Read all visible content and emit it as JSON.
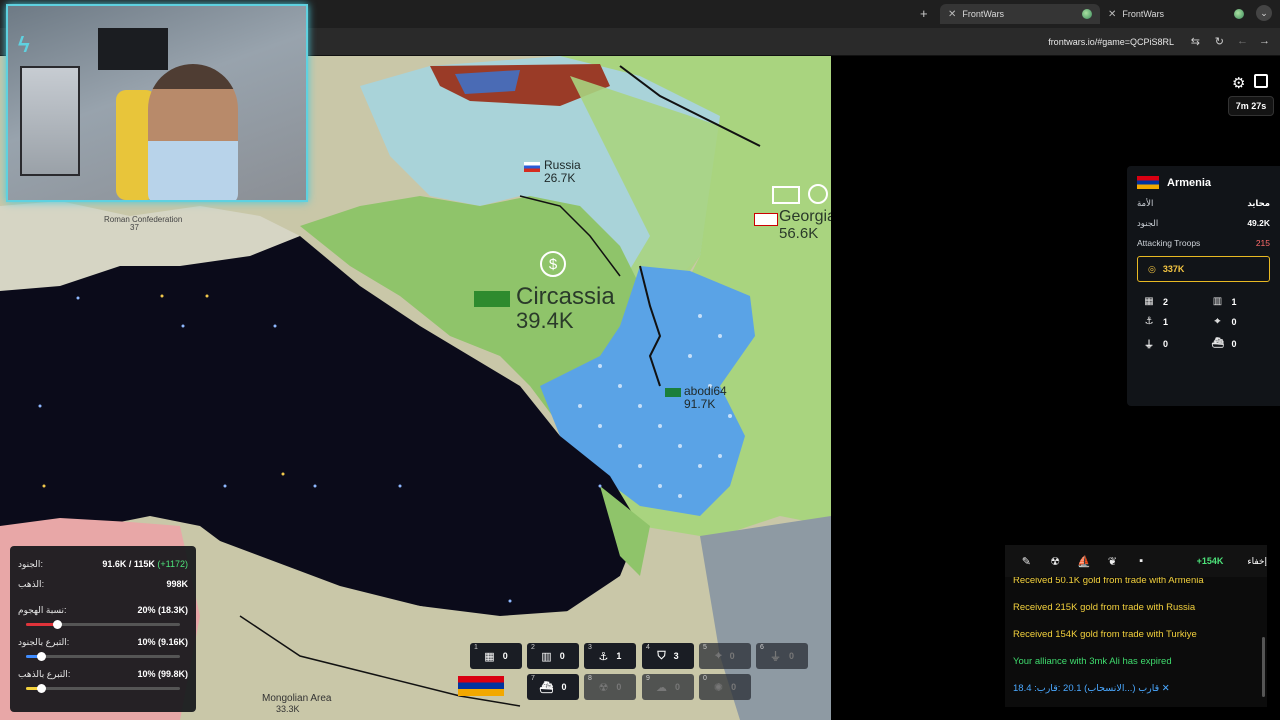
{
  "browser": {
    "tabs": [
      {
        "label": "FrontWars",
        "active": true
      },
      {
        "label": "FrontWars",
        "active": false
      }
    ],
    "url": "frontwars.io/#game=QCPiS8RL"
  },
  "map": {
    "regions": [
      {
        "name": "Russia",
        "troops": "26.7K"
      },
      {
        "name": "Georgia",
        "troops": "56.6K"
      },
      {
        "name": "Circassia",
        "troops": "39.4K"
      },
      {
        "name": "abodi64",
        "troops": "91.7K"
      },
      {
        "name": "Roman Confederation",
        "troops": "37"
      },
      {
        "name": "Mongolian Area",
        "troops": "33.3K"
      }
    ]
  },
  "hud": {
    "timer": "7m 27s"
  },
  "player": {
    "name": "Armenia",
    "rows": [
      {
        "label": "الأمة",
        "value": "محايد"
      },
      {
        "label": "الجنود",
        "value": "49.2K"
      },
      {
        "label": "Attacking Troops",
        "value": "215"
      }
    ],
    "gold": "337K",
    "buildings": [
      {
        "icon": "city-icon",
        "glyph": "▦",
        "count": "2"
      },
      {
        "icon": "factory-icon",
        "glyph": "▥",
        "count": "1"
      },
      {
        "icon": "port-icon",
        "glyph": "⚓",
        "count": "1"
      },
      {
        "icon": "sam-icon",
        "glyph": "⌖",
        "count": "0"
      },
      {
        "icon": "missile-silo-icon",
        "glyph": "⏚",
        "count": "0"
      },
      {
        "icon": "warship-icon",
        "glyph": "⛴",
        "count": "0"
      }
    ]
  },
  "actions": {
    "gold_change": "+154K",
    "hide_label": "إخفاء"
  },
  "feed": [
    {
      "text": "Received 50.1K gold from trade with Armenia",
      "color": "yellow"
    },
    {
      "text": "Received 215K gold from trade with Russia",
      "color": "yellow"
    },
    {
      "text": "Received 154K gold from trade with Turkiye",
      "color": "yellow"
    },
    {
      "text": "Your alliance with 3mk Ali has expired",
      "color": "green"
    },
    {
      "text": "18.4 :قارب (...الانسحاب) 20.1 :قارب ✕",
      "color": "blue"
    }
  ],
  "stats": {
    "troops_label": "الجنود:",
    "troops_value": "91.6K / 115K",
    "troops_rate": "(+1172)",
    "gold_label": "الذهب:",
    "gold_value": "998K",
    "attack_label": "نسبة الهجوم:",
    "attack_value": "20% (18.3K)",
    "attack_ratio": 0.2,
    "donate_troops_label": "التبرع بالجنود:",
    "donate_troops_value": "10% (9.16K)",
    "donate_troops_ratio": 0.1,
    "donate_gold_label": "التبرع بالذهب:",
    "donate_gold_value": "10% (99.8K)",
    "donate_gold_ratio": 0.1
  },
  "build_bar": [
    {
      "key": "1",
      "icon": "city-icon",
      "glyph": "▦",
      "count": "0",
      "enabled": true
    },
    {
      "key": "2",
      "icon": "factory-icon",
      "glyph": "▥",
      "count": "0",
      "enabled": true
    },
    {
      "key": "3",
      "icon": "port-icon",
      "glyph": "⚓",
      "count": "1",
      "enabled": true
    },
    {
      "key": "4",
      "icon": "defense-post-icon",
      "glyph": "⛉",
      "count": "3",
      "enabled": true
    },
    {
      "key": "5",
      "icon": "sam-icon",
      "glyph": "⌖",
      "count": "0",
      "enabled": false
    },
    {
      "key": "6",
      "icon": "missile-silo-icon",
      "glyph": "⏚",
      "count": "0",
      "enabled": false
    },
    {
      "key": "7",
      "icon": "warship-icon",
      "glyph": "⛴",
      "count": "0",
      "enabled": true
    },
    {
      "key": "8",
      "icon": "nuke-icon",
      "glyph": "☢",
      "count": "0",
      "enabled": false
    },
    {
      "key": "9",
      "icon": "hydrogen-bomb-icon",
      "glyph": "☁",
      "count": "0",
      "enabled": false
    },
    {
      "key": "0",
      "icon": "mirv-icon",
      "glyph": "✺",
      "count": "0",
      "enabled": false
    }
  ]
}
